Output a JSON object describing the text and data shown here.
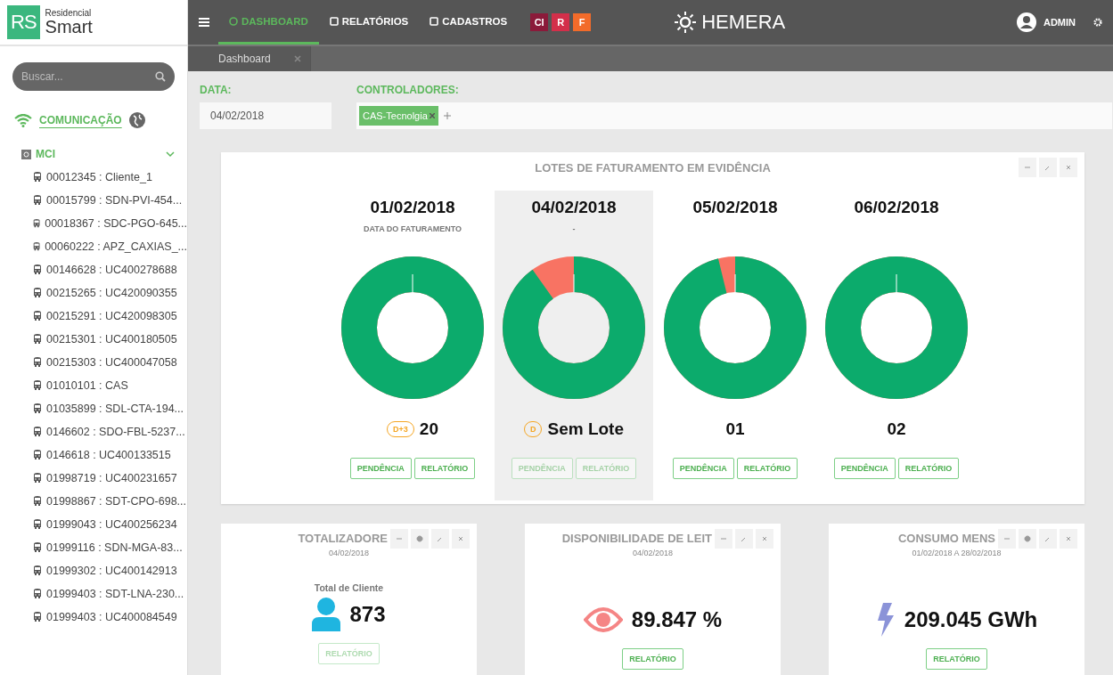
{
  "brand": {
    "mark": "RS",
    "line1": "Residencial",
    "line2": "Smart"
  },
  "search": {
    "placeholder": "Buscar..."
  },
  "sidebar": {
    "section": "COMUNICAÇÃO",
    "group": {
      "label": "MCI",
      "expanded": true,
      "items": [
        {
          "label": "00012345 : Cliente_1"
        },
        {
          "label": "00015799 : SDN-PVI-454..."
        },
        {
          "label": "00018367 : SDC-PGO-645..."
        },
        {
          "label": "00060222 : APZ_CAXIAS_..."
        },
        {
          "label": "00146628 : UC400278688"
        },
        {
          "label": "00215265 : UC420090355"
        },
        {
          "label": "00215291 : UC420098305"
        },
        {
          "label": "00215301 : UC400180505"
        },
        {
          "label": "00215303 : UC400047058"
        },
        {
          "label": "01010101 : CAS"
        },
        {
          "label": "01035899 : SDL-CTA-194..."
        },
        {
          "label": "0146602 : SDO-FBL-5237..."
        },
        {
          "label": "0146618 : UC400133515"
        },
        {
          "label": "01998719 : UC400231657"
        },
        {
          "label": "01998867 : SDT-CPO-698..."
        },
        {
          "label": "01999043 : UC400256234"
        },
        {
          "label": "01999116 : SDN-MGA-83..."
        },
        {
          "label": "01999302 : UC400142913"
        },
        {
          "label": "01999403 : SDT-LNA-230..."
        },
        {
          "label": "01999403 : UC400084549"
        }
      ]
    }
  },
  "nav": [
    {
      "label": "DASHBOARD",
      "selected": true
    },
    {
      "label": "RELATÓRIOS",
      "selected": false
    },
    {
      "label": "CADASTROS",
      "selected": false
    }
  ],
  "apps": [
    {
      "label": "CI",
      "color": "#8b1a3a"
    },
    {
      "label": "R",
      "color": "#d32f4a"
    },
    {
      "label": "F",
      "color": "#f26b2a"
    }
  ],
  "product": "HEMERA",
  "user": "ADMIN",
  "tabs": [
    {
      "label": "Dashboard",
      "selected": true
    }
  ],
  "filters": {
    "date_label": "DATA:",
    "date_value": "04/02/2018",
    "controllers_label": "CONTROLADORES:",
    "controllers": [
      "CAS-Tecnolgia"
    ]
  },
  "lots_panel": {
    "title": "LOTES DE FATURAMENTO EM EVIDÊNCIA",
    "lots": [
      {
        "date": "01/02/2018",
        "subtitle": "DATA DO FATURAMENTO",
        "level": 1,
        "badge": "D+3",
        "value": "20",
        "selected": false,
        "disabled": false,
        "buttons": [
          "PENDÊNCIA",
          "RELATÓRIO"
        ]
      },
      {
        "date": "04/02/2018",
        "subtitle": "-",
        "level": 0.9,
        "badge": "D",
        "value": "Sem Lote",
        "selected": true,
        "disabled": true,
        "buttons": [
          "PENDÊNCIA",
          "RELATÓRIO"
        ]
      },
      {
        "date": "05/02/2018",
        "level": 0.96,
        "value": "01",
        "selected": false,
        "disabled": false,
        "buttons": [
          "PENDÊNCIA",
          "RELATÓRIO"
        ]
      },
      {
        "date": "06/02/2018",
        "level": 1,
        "value": "02",
        "selected": false,
        "disabled": false,
        "buttons": [
          "PENDÊNCIA",
          "RELATÓRIO"
        ]
      }
    ]
  },
  "widgets": [
    {
      "kind": "clients",
      "title": "TOTALIZADORE",
      "date": "04/02/2018",
      "caption": "Total de Cliente",
      "value": "873",
      "button": "RELATÓRIO",
      "disabled": true,
      "settings": true
    },
    {
      "kind": "availability",
      "title": "DISPONIBILIDADE DE LEIT",
      "date": "04/02/2018",
      "value": "89.847 %",
      "button": "RELATÓRIO",
      "disabled": false,
      "settings": false
    },
    {
      "kind": "consumption",
      "title": "CONSUMO MENS",
      "date": "01/02/2018 A 28/02/2018",
      "value": "209.045 GWh",
      "button": "RELATÓRIO",
      "disabled": false,
      "settings": true
    }
  ]
}
